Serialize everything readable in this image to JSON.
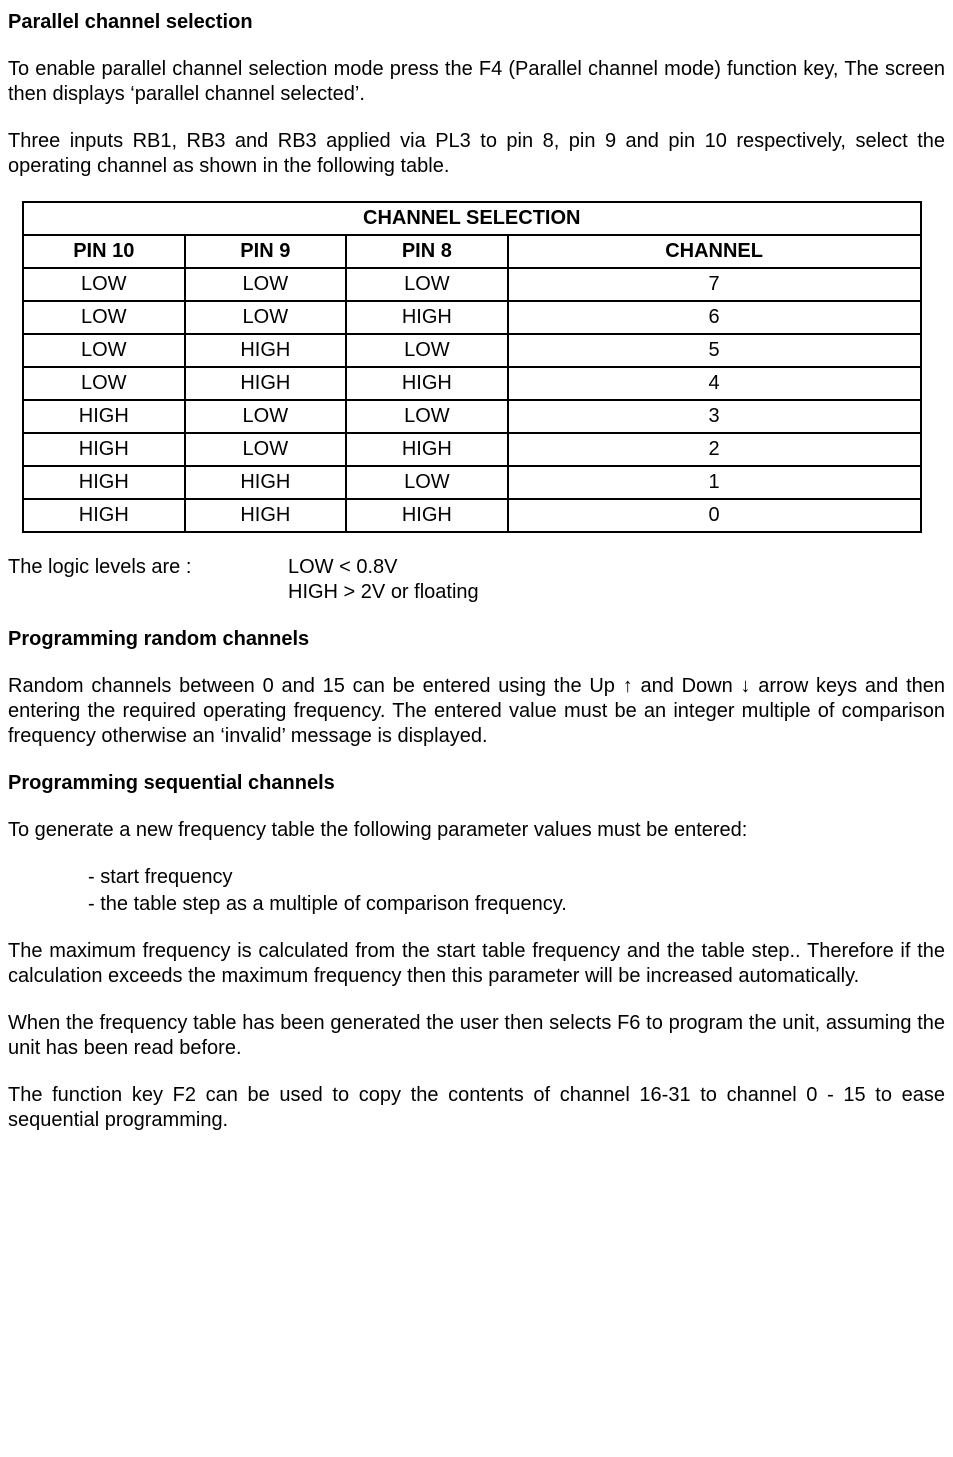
{
  "section1": {
    "heading": "Parallel channel selection",
    "para1": "To enable parallel channel selection mode press the F4 (Parallel channel mode) function key,  The screen then displays ‘parallel channel selected’.",
    "para2": "Three inputs RB1, RB3 and RB3 applied via PL3 to pin 8, pin 9 and pin 10 respectively, select the operating channel as shown in the following table."
  },
  "table": {
    "title": "CHANNEL SELECTION",
    "headers": {
      "pin10": "PIN 10",
      "pin9": "PIN 9",
      "pin8": "PIN 8",
      "channel": "CHANNEL"
    },
    "rows": [
      {
        "pin10": "LOW",
        "pin9": "LOW",
        "pin8": "LOW",
        "channel": "7"
      },
      {
        "pin10": "LOW",
        "pin9": "LOW",
        "pin8": "HIGH",
        "channel": "6"
      },
      {
        "pin10": "LOW",
        "pin9": "HIGH",
        "pin8": "LOW",
        "channel": "5"
      },
      {
        "pin10": "LOW",
        "pin9": "HIGH",
        "pin8": "HIGH",
        "channel": "4"
      },
      {
        "pin10": "HIGH",
        "pin9": "LOW",
        "pin8": "LOW",
        "channel": "3"
      },
      {
        "pin10": "HIGH",
        "pin9": "LOW",
        "pin8": "HIGH",
        "channel": "2"
      },
      {
        "pin10": "HIGH",
        "pin9": "HIGH",
        "pin8": "LOW",
        "channel": "1"
      },
      {
        "pin10": "HIGH",
        "pin9": "HIGH",
        "pin8": "HIGH",
        "channel": "0"
      }
    ]
  },
  "logic": {
    "label": "The logic levels are :",
    "low": "LOW < 0.8V",
    "high": "HIGH > 2V or floating"
  },
  "section2": {
    "heading": "Programming random channels",
    "para1": "Random channels between 0 and 15 can be entered using the Up ↑ and Down ↓ arrow keys and then entering the required operating frequency.  The entered value must be an integer multiple of comparison frequency otherwise an ‘invalid’ message is displayed."
  },
  "section3": {
    "heading": "Programming sequential channels",
    "para1": "To generate a new frequency table the following parameter values must be entered:",
    "bullets": {
      "b1": "- start frequency",
      "b2": "- the table step as a multiple of comparison frequency."
    },
    "para2": "The maximum frequency is calculated from the start table frequency and the table step.. Therefore if the calculation exceeds the maximum frequency then this parameter will be increased automatically.",
    "para3": "When the frequency table has been generated the user then selects F6 to program the unit, assuming the unit has been read before.",
    "para4": "The function key F2 can be used to copy the contents of channel 16-31 to channel 0 - 15 to ease sequential programming."
  }
}
